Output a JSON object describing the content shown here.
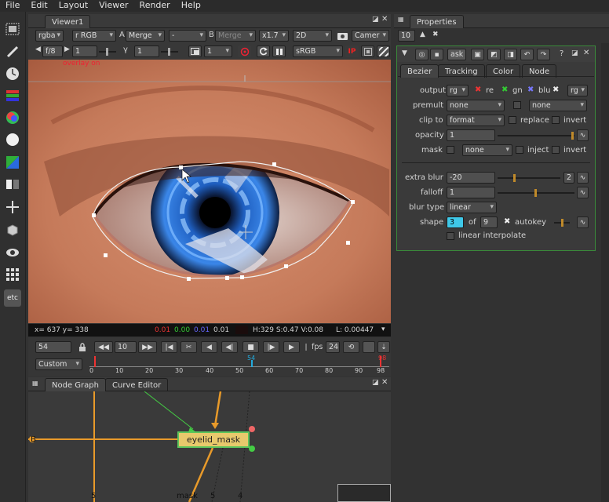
{
  "menu": [
    "File",
    "Edit",
    "Layout",
    "Viewer",
    "Render",
    "Help"
  ],
  "viewer": {
    "tab": "Viewer1",
    "channels": "rgba",
    "layer": "r RGB",
    "a_label": "A",
    "merge": "Merge",
    "dash": "-",
    "b_label": "B",
    "b_merge": "Merge",
    "zoom": "x1.7",
    "mode": "2D",
    "camera": "Camer",
    "fstop": "f/8",
    "gain": "1",
    "gamma_label": "γ",
    "gamma": "1",
    "proxy": "1",
    "lut": "sRGB",
    "overlay": "overlay on",
    "status": {
      "coords": "x= 637 y= 338",
      "r": "0.01",
      "g": "0.00",
      "b": "0.01",
      "a": "0.01",
      "hsv": "H:329 S:0.47 V:0.08",
      "lum": "L: 0.00447"
    }
  },
  "timeline": {
    "frame": "54",
    "step": "10",
    "fps_label": "fps",
    "fps": "24",
    "range": "Custom",
    "ticks": [
      "0",
      "10",
      "20",
      "30",
      "40",
      "50",
      "60",
      "70",
      "80",
      "90",
      "98"
    ],
    "current": "54",
    "end": "98"
  },
  "graph": {
    "tabs": [
      "Node Graph",
      "Curve Editor"
    ],
    "node": "eyelid_mask",
    "labels": [
      "B",
      "5",
      "mask",
      "5",
      "4"
    ]
  },
  "properties": {
    "tab": "Properties",
    "count": "10",
    "node_name": "ask",
    "tabs": [
      "Bezier",
      "Tracking",
      "Color",
      "Node"
    ],
    "output_label": "output",
    "output": "rg",
    "ch_r": "re",
    "ch_g": "gn",
    "ch_b": "blu",
    "output2": "rg",
    "premult_label": "premult",
    "premult": "none",
    "premult2": "none",
    "clip_label": "clip to",
    "clip": "format",
    "replace": "replace",
    "invert": "invert",
    "opacity_label": "opacity",
    "opacity": "1",
    "mask_label": "mask",
    "mask": "none",
    "inject": "inject",
    "invert2": "invert",
    "extra_label": "extra blur",
    "extra": "-20",
    "extra_mult": "2",
    "falloff_label": "falloff",
    "falloff": "1",
    "blurtype_label": "blur type",
    "blurtype": "linear",
    "shape_label": "shape",
    "shape": "3",
    "of_label": "of",
    "of": "9",
    "autokey": "autokey",
    "linear_interp": "linear interpolate"
  },
  "colors": {
    "bg": "#323232",
    "panel_border": "#3a8a3a",
    "accent": "#e89a2a",
    "node": "#e8c96c"
  }
}
